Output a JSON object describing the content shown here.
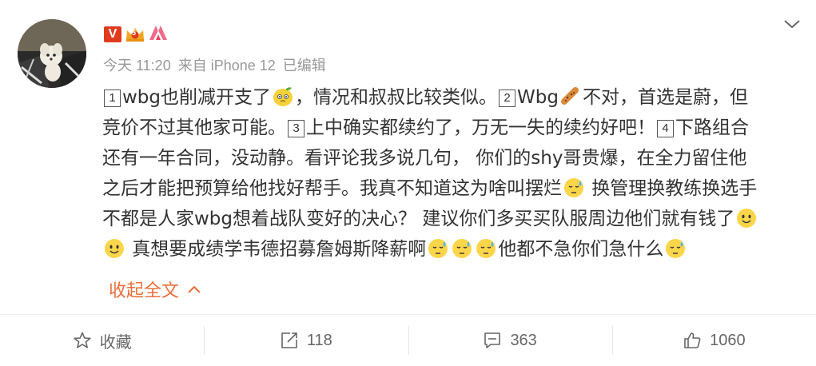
{
  "post": {
    "meta": {
      "time": "今天 11:20",
      "source": "来自 iPhone 12",
      "edited": "已编辑"
    },
    "badges": {
      "verified_letter": "V",
      "level": "5"
    },
    "content": {
      "l1_num": "1",
      "l1_a": "wbg也削减开支了",
      "l1_b": "，情况和叔叔比较类似。",
      "l1_num2": "2",
      "l1_c": "Wbg",
      "l1_d": "不对，首选是蔚，但",
      "l2_a": "竞价不过其他家可能。",
      "l2_num": "3",
      "l2_b": "上中确实都续约了，万无一失的续约好吧！",
      "l2_num2": "4",
      "l2_c": "下路组合",
      "l3": "还有一年合同，没动静。看评论我多说几句， 你们的shy哥贵爆，在全力留住他",
      "l4_a": "之后才能把预算给他找好帮手。我真不知道这为啥叫摆烂",
      "l4_b": " 换管理换教练换选手",
      "l5_a": "不都是人家wbg想着战队变好的决心？  建议你们多买买队服周边他们就有钱了",
      "l6_a": " 真想要成绩学韦德招募詹姆斯降薪啊",
      "l6_b": "他都不急你们急什么"
    },
    "collapse_label": "收起全文"
  },
  "actions": {
    "favorite_label": "收藏",
    "repost_count": "118",
    "comment_count": "363",
    "like_count": "1060"
  },
  "colors": {
    "accent": "#e8703c",
    "text": "#333333",
    "meta": "#999999",
    "verified": "#e03a1f"
  },
  "icons": [
    "verified-v-icon",
    "level-crown-icon",
    "member-icon",
    "chevron-down-icon",
    "lemon-emoji",
    "cookie-emoji",
    "sweat-emoji",
    "smile-emoji",
    "chevron-up-icon",
    "star-icon",
    "repost-icon",
    "comment-icon",
    "like-icon"
  ]
}
